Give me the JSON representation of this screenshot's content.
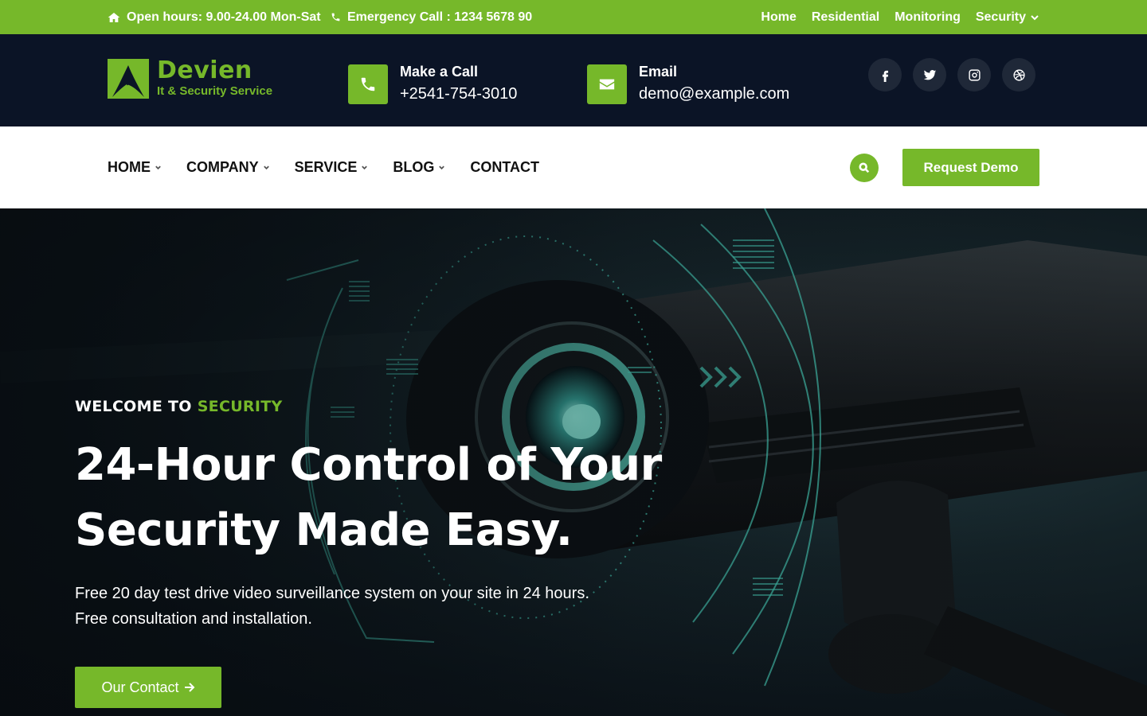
{
  "topbar": {
    "hours": "Open hours: 9.00-24.00 Mon-Sat",
    "emergency": "Emergency Call : 1234 5678 90",
    "links": [
      "Home",
      "Residential",
      "Monitoring",
      "Security"
    ]
  },
  "header": {
    "brand": "Devien",
    "tagline": "It & Security Service",
    "call_label": "Make a Call",
    "call_value": "+2541-754-3010",
    "email_label": "Email",
    "email_value": "demo@example.com",
    "socials": [
      "facebook-icon",
      "twitter-icon",
      "instagram-icon",
      "dribbble-icon"
    ]
  },
  "nav": {
    "items": [
      "HOME",
      "COMPANY",
      "SERVICE",
      "BLOG",
      "CONTACT"
    ],
    "cta": "Request Demo"
  },
  "hero": {
    "welcome_prefix": "WELCOME TO",
    "welcome_highlight": "SECURITY",
    "headline_line1": "24-Hour Control of Your",
    "headline_line2": "Security Made Easy.",
    "sub_line1": "Free 20 day test drive video surveillance system on your site in 24 hours.",
    "sub_line2": "Free consultation and installation.",
    "cta": "Our Contact"
  },
  "colors": {
    "accent": "#76b82a",
    "header_bg": "#0b1426",
    "teal": "#3aa89a"
  }
}
